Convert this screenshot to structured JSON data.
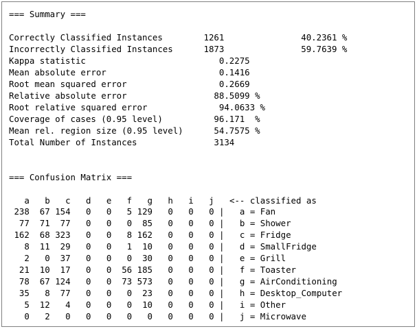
{
  "summary": {
    "header": "=== Summary ===",
    "stats": [
      {
        "label": "Correctly Classified Instances",
        "value": "1261",
        "pct": "40.2361 %"
      },
      {
        "label": "Incorrectly Classified Instances",
        "value": "1873",
        "pct": "59.7639 %"
      },
      {
        "label": "Kappa statistic",
        "value": "0.2275"
      },
      {
        "label": "Mean absolute error",
        "value": "0.1416"
      },
      {
        "label": "Root mean squared error",
        "value": "0.2669"
      },
      {
        "label": "Relative absolute error",
        "value": "88.5099 %"
      },
      {
        "label": "Root relative squared error",
        "value": "94.0633 %"
      },
      {
        "label": "Coverage of cases (0.95 level)",
        "value": "96.171  %"
      },
      {
        "label": "Mean rel. region size (0.95 level)",
        "value": "54.7575 %"
      },
      {
        "label": "Total Number of Instances",
        "value": "3134"
      }
    ]
  },
  "confusion_matrix": {
    "header": "=== Confusion Matrix ===",
    "columns": [
      "a",
      "b",
      "c",
      "d",
      "e",
      "f",
      "g",
      "h",
      "i",
      "j"
    ],
    "classified_as_label": "<-- classified as",
    "rows": [
      {
        "cells": [
          "238",
          "67",
          "154",
          "0",
          "0",
          "5",
          "129",
          "0",
          "0",
          "0"
        ],
        "key": "a",
        "cls": "Fan"
      },
      {
        "cells": [
          "77",
          "71",
          "77",
          "0",
          "0",
          "0",
          "85",
          "0",
          "0",
          "0"
        ],
        "key": "b",
        "cls": "Shower"
      },
      {
        "cells": [
          "162",
          "68",
          "323",
          "0",
          "0",
          "8",
          "162",
          "0",
          "0",
          "0"
        ],
        "key": "c",
        "cls": "Fridge"
      },
      {
        "cells": [
          "8",
          "11",
          "29",
          "0",
          "0",
          "1",
          "10",
          "0",
          "0",
          "0"
        ],
        "key": "d",
        "cls": "SmallFridge"
      },
      {
        "cells": [
          "2",
          "0",
          "37",
          "0",
          "0",
          "0",
          "30",
          "0",
          "0",
          "0"
        ],
        "key": "e",
        "cls": "Grill"
      },
      {
        "cells": [
          "21",
          "10",
          "17",
          "0",
          "0",
          "56",
          "185",
          "0",
          "0",
          "0"
        ],
        "key": "f",
        "cls": "Toaster"
      },
      {
        "cells": [
          "78",
          "67",
          "124",
          "0",
          "0",
          "73",
          "573",
          "0",
          "0",
          "0"
        ],
        "key": "g",
        "cls": "AirConditioning"
      },
      {
        "cells": [
          "35",
          "8",
          "77",
          "0",
          "0",
          "0",
          "23",
          "0",
          "0",
          "0"
        ],
        "key": "h",
        "cls": "Desktop_Computer"
      },
      {
        "cells": [
          "5",
          "12",
          "4",
          "0",
          "0",
          "0",
          "10",
          "0",
          "0",
          "0"
        ],
        "key": "i",
        "cls": "Other"
      },
      {
        "cells": [
          "0",
          "2",
          "0",
          "0",
          "0",
          "0",
          "0",
          "0",
          "0",
          "0"
        ],
        "key": "j",
        "cls": "Microwave"
      }
    ]
  }
}
